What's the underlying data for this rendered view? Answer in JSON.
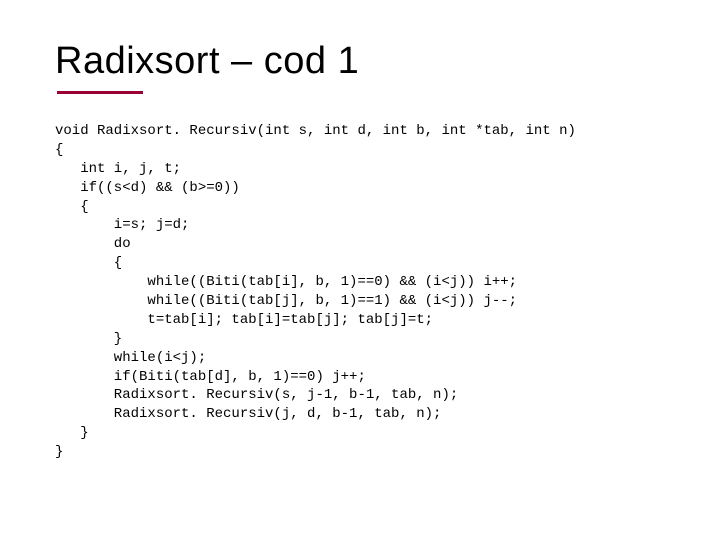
{
  "title": "Radixsort – cod 1",
  "code": {
    "l01": "void Radixsort. Recursiv(int s, int d, int b, int *tab, int n)",
    "l02": "{",
    "l03": "   int i, j, t;",
    "l04": "   if((s<d) && (b>=0))",
    "l05": "   {",
    "l06": "       i=s; j=d;",
    "l07": "       do",
    "l08": "       {",
    "l09": "           while((Biti(tab[i], b, 1)==0) && (i<j)) i++;",
    "l10": "           while((Biti(tab[j], b, 1)==1) && (i<j)) j--;",
    "l11": "           t=tab[i]; tab[i]=tab[j]; tab[j]=t;",
    "l12": "       }",
    "l13": "       while(i<j);",
    "l14": "       if(Biti(tab[d], b, 1)==0) j++;",
    "l15": "       Radixsort. Recursiv(s, j-1, b-1, tab, n);",
    "l16": "       Radixsort. Recursiv(j, d, b-1, tab, n);",
    "l17": "   }",
    "l18": "}"
  }
}
